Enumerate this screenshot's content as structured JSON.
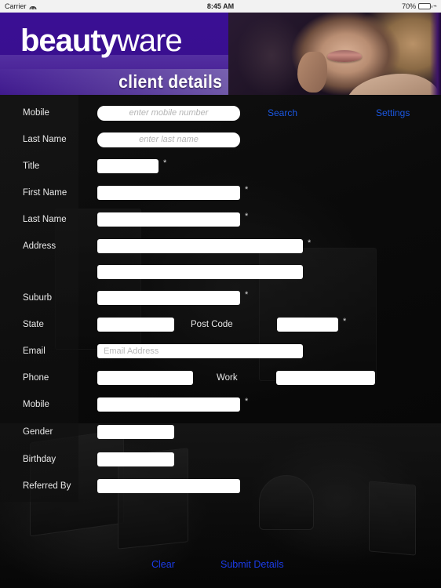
{
  "status_bar": {
    "carrier": "Carrier",
    "wifi_icon": "wifi-icon",
    "time": "8:45 AM",
    "battery_percent": "70%",
    "battery_icon": "battery-icon",
    "charging_icon": "plug-icon"
  },
  "header": {
    "logo_bold": "beauty",
    "logo_light": "ware",
    "subtitle": "client details",
    "photo_alt": "model-portrait-photo",
    "colors": {
      "purple_dark": "#3a0f94",
      "purple_light": "#5535a8"
    }
  },
  "search": {
    "mobile_label": "Mobile",
    "mobile_placeholder": "enter mobile number",
    "mobile_value": "",
    "last_name_label": "Last Name",
    "last_name_placeholder": "enter last name",
    "last_name_value": "",
    "search_link": "Search",
    "settings_link": "Settings"
  },
  "details": {
    "required_marker": "*",
    "title_label": "Title",
    "title_value": "",
    "first_name_label": "First Name",
    "first_name_value": "",
    "last_name_label": "Last Name",
    "last_name_value": "",
    "address_label": "Address",
    "address1_value": "",
    "address2_value": "",
    "suburb_label": "Suburb",
    "suburb_value": "",
    "state_label": "State",
    "state_value": "",
    "post_code_label": "Post Code",
    "post_code_value": "",
    "email_label": "Email",
    "email_placeholder": "Email Address",
    "email_value": "",
    "phone_label": "Phone",
    "phone_value": "",
    "work_label": "Work",
    "work_value": "",
    "mobile_label": "Mobile",
    "mobile_value": "",
    "gender_label": "Gender",
    "gender_value": "",
    "birthday_label": "Birthday",
    "birthday_value": "",
    "referred_by_label": "Referred By",
    "referred_by_value": ""
  },
  "footer": {
    "clear_button": "Clear",
    "submit_button": "Submit Details",
    "link_color": "#1b3ce8"
  }
}
